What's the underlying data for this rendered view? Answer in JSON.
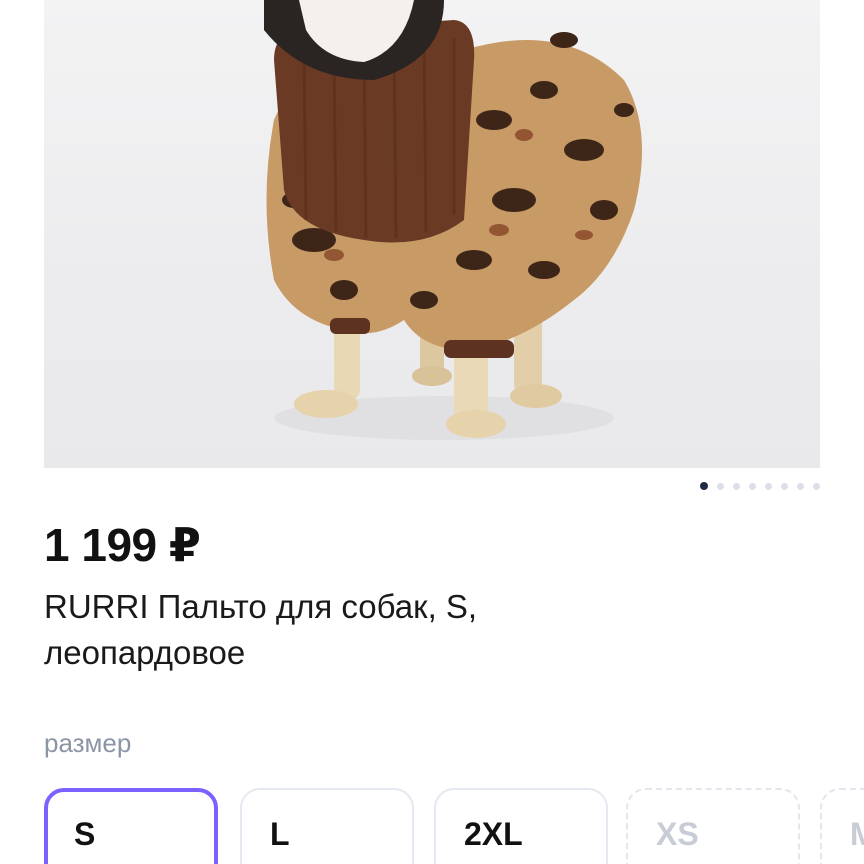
{
  "product": {
    "price": "1 199 ₽",
    "title": "RURRI Пальто для собак, S, леопардовое"
  },
  "gallery": {
    "image_description_icon": "product-photo",
    "dots_count": 8,
    "active_dot": 0
  },
  "size_selector": {
    "label": "размер",
    "options": [
      {
        "label": "S",
        "state": "selected"
      },
      {
        "label": "L",
        "state": "available"
      },
      {
        "label": "2XL",
        "state": "available"
      },
      {
        "label": "XS",
        "state": "unavailable"
      },
      {
        "label": "M",
        "state": "unavailable"
      }
    ]
  },
  "colors": {
    "accent": "#7b61ff",
    "price_text": "#111111",
    "muted_text": "#8c95a6",
    "dot_active": "#1f2a44",
    "dot_inactive": "#dcdfe6"
  }
}
